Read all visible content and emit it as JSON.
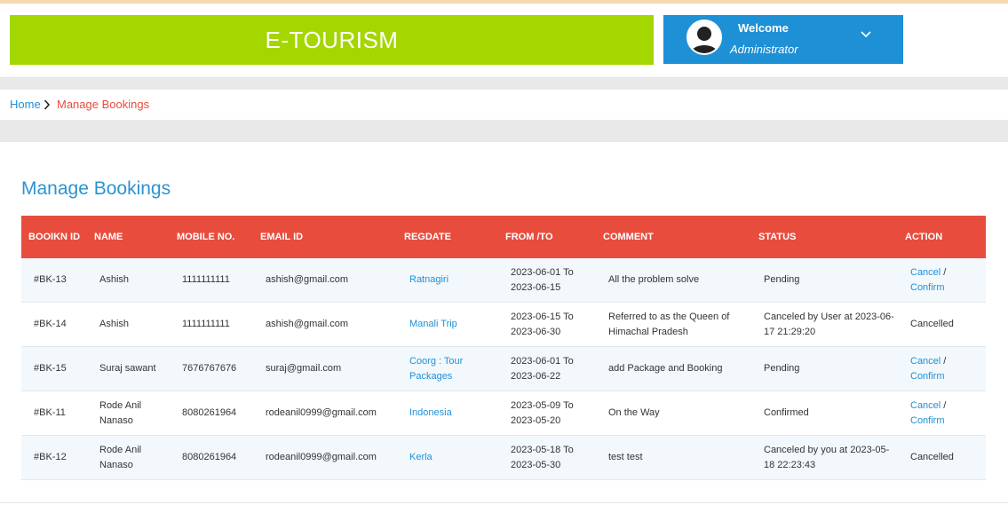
{
  "header": {
    "logo": "E-TOURISM",
    "welcome": "Welcome",
    "role": "Administrator"
  },
  "breadcrumb": {
    "home": "Home",
    "current": "Manage Bookings"
  },
  "page_title": "Manage Bookings",
  "table": {
    "columns": [
      "BOOIKN ID",
      "NAME",
      "MOBILE NO.",
      "EMAIL ID",
      "REGDATE",
      "FROM /TO",
      "COMMENT",
      "STATUS",
      "ACTION"
    ],
    "rows": [
      {
        "id": "#BK-13",
        "name": "Ashish",
        "mobile": "1111111111",
        "email": "ashish@gmail.com",
        "regdate": "Ratnagiri",
        "fromto": "2023-06-01 To 2023-06-15",
        "comment": "All the problem solve",
        "status": "Pending",
        "action_cancel": "Cancel",
        "action_sep": " /",
        "action_confirm": "Confirm",
        "action_text": ""
      },
      {
        "id": "#BK-14",
        "name": "Ashish",
        "mobile": "1111111111",
        "email": "ashish@gmail.com",
        "regdate": "Manali Trip",
        "fromto": "2023-06-15 To 2023-06-30",
        "comment": "Referred to as the Queen of Himachal Pradesh",
        "status": "Canceled by User at 2023-06-17 21:29:20",
        "action_cancel": "",
        "action_sep": "",
        "action_confirm": "",
        "action_text": "Cancelled"
      },
      {
        "id": "#BK-15",
        "name": "Suraj sawant",
        "mobile": "7676767676",
        "email": "suraj@gmail.com",
        "regdate": "Coorg : Tour Packages",
        "fromto": "2023-06-01 To 2023-06-22",
        "comment": "add Package and Booking",
        "status": "Pending",
        "action_cancel": "Cancel",
        "action_sep": " /",
        "action_confirm": "Confirm",
        "action_text": ""
      },
      {
        "id": "#BK-11",
        "name": "Rode Anil Nanaso",
        "mobile": "8080261964",
        "email": "rodeanil0999@gmail.com",
        "regdate": "Indonesia",
        "fromto": "2023-05-09 To 2023-05-20",
        "comment": "On the Way",
        "status": "Confirmed",
        "action_cancel": "Cancel",
        "action_sep": " /",
        "action_confirm": "Confirm",
        "action_text": ""
      },
      {
        "id": "#BK-12",
        "name": "Rode Anil Nanaso",
        "mobile": "8080261964",
        "email": "rodeanil0999@gmail.com",
        "regdate": "Kerla",
        "fromto": "2023-05-18 To 2023-05-30",
        "comment": "test test",
        "status": "Canceled by you at 2023-05-18 22:23:43",
        "action_cancel": "",
        "action_sep": "",
        "action_confirm": "",
        "action_text": "Cancelled"
      }
    ]
  },
  "colors": {
    "logo_bg": "#a4d600",
    "user_bg": "#1e90d6",
    "table_header": "#e84c3d",
    "link": "#1e90d6",
    "title": "#2b93d1"
  },
  "icons": [
    "user-avatar-icon",
    "chevron-down-icon",
    "chevron-right-icon"
  ]
}
